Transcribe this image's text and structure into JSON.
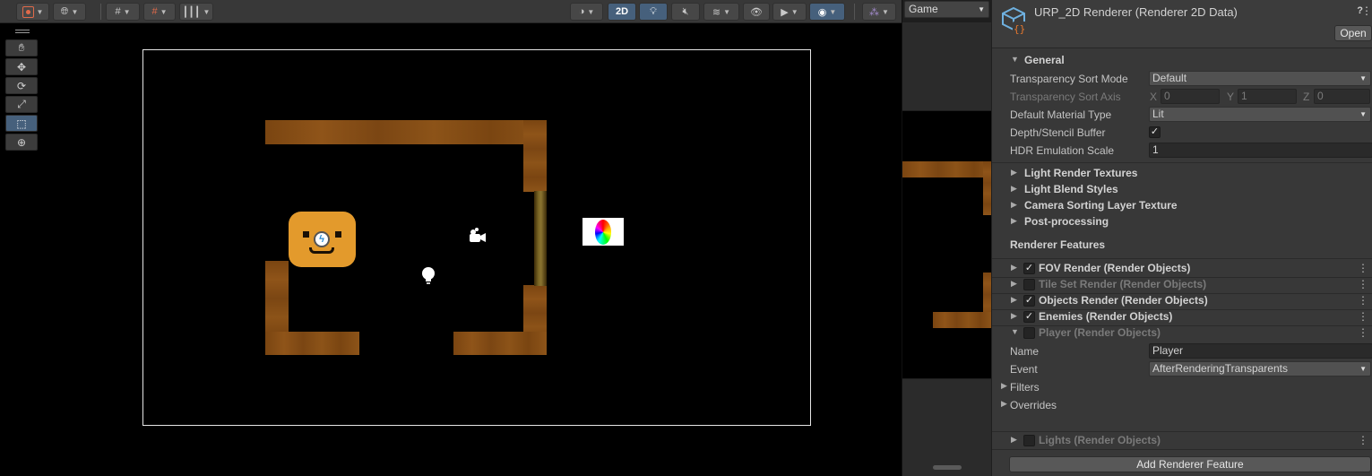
{
  "scene_toolbar": {
    "mode_2d_label": "2D",
    "icons": [
      "gizmo-icon",
      "global-icon",
      "grid-snap-icon",
      "increment-snap-icon",
      "ruler-icon",
      "shading-icon",
      "2d-toggle",
      "lighting-icon",
      "audio-icon",
      "effects-icon",
      "visibility-icon",
      "camera-icon",
      "gizmos-icon",
      "layers-icon"
    ]
  },
  "tools": [
    "hand-tool",
    "move-tool",
    "rotate-tool",
    "scale-tool",
    "rect-tool",
    "transform-tool"
  ],
  "game_view": {
    "display_label": "Game"
  },
  "inspector": {
    "title": "URP_2D Renderer (Renderer 2D Data)",
    "open_label": "Open",
    "general": {
      "label": "General",
      "transparency_sort_mode": {
        "label": "Transparency Sort Mode",
        "value": "Default"
      },
      "transparency_sort_axis": {
        "label": "Transparency Sort Axis",
        "x_label": "X",
        "x": "0",
        "y_label": "Y",
        "y": "1",
        "z_label": "Z",
        "z": "0"
      },
      "default_material_type": {
        "label": "Default Material Type",
        "value": "Lit"
      },
      "depth_stencil_buffer": {
        "label": "Depth/Stencil Buffer",
        "checked": true
      },
      "hdr_emulation_scale": {
        "label": "HDR Emulation Scale",
        "value": "1"
      }
    },
    "sections": [
      "Light Render Textures",
      "Light Blend Styles",
      "Camera Sorting Layer Texture",
      "Post-processing"
    ],
    "renderer_features_label": "Renderer Features",
    "features": [
      {
        "label": "FOV Render (Render Objects)",
        "enabled": true
      },
      {
        "label": "Tile Set Render (Render Objects)",
        "enabled": false
      },
      {
        "label": "Objects Render (Render Objects)",
        "enabled": true
      },
      {
        "label": "Enemies (Render Objects)",
        "enabled": true
      },
      {
        "label": "Player (Render Objects)",
        "enabled": false
      }
    ],
    "player_feature": {
      "name_label": "Name",
      "name_value": "Player",
      "event_label": "Event",
      "event_value": "AfterRenderingTransparents",
      "filters_label": "Filters",
      "overrides_label": "Overrides"
    },
    "lights_feature": {
      "label": "Lights (Render Objects)",
      "enabled": false
    },
    "add_feature_label": "Add Renderer Feature",
    "kebab_glyph": "⋮"
  }
}
